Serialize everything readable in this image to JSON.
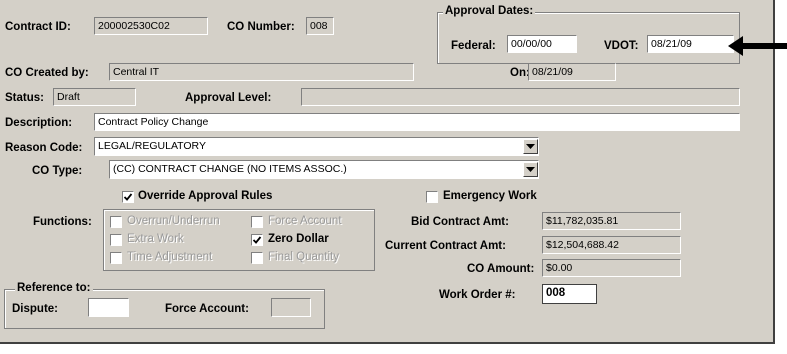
{
  "labels": {
    "contract_id": "Contract ID:",
    "co_number": "CO Number:",
    "approval_dates": "Approval Dates:",
    "federal": "Federal:",
    "vdot": "VDOT:",
    "co_created_by": "CO Created by:",
    "on": "On:",
    "status": "Status:",
    "approval_level": "Approval Level:",
    "description": "Description:",
    "reason_code": "Reason Code:",
    "co_type": "CO Type:",
    "override": "Override Approval Rules",
    "emergency": "Emergency Work",
    "functions": "Functions:",
    "bid_amt": "Bid Contract Amt:",
    "current_amt": "Current Contract Amt:",
    "co_amount": "CO Amount:",
    "work_order": "Work Order #:",
    "reference_to": "Reference to:",
    "dispute": "Dispute:",
    "force_account": "Force Account:"
  },
  "values": {
    "contract_id": "200002530C02",
    "co_number": "008",
    "federal": "00/00/00",
    "vdot": "08/21/09",
    "co_created_by": "Central IT",
    "on": "08/21/09",
    "status": "Draft",
    "approval_level": "",
    "description": "Contract Policy Change",
    "reason_code": "LEGAL/REGULATORY",
    "co_type": "(CC) CONTRACT CHANGE (NO ITEMS ASSOC.)",
    "bid_amt": "$11,782,035.81",
    "current_amt": "$12,504,688.42",
    "co_amount": "$0.00",
    "work_order": "008",
    "dispute": "",
    "force_account": ""
  },
  "checkboxes": {
    "override": true,
    "emergency": false
  },
  "functions": [
    {
      "label": "Overrun/Underrun",
      "checked": false,
      "enabled": false
    },
    {
      "label": "Force Account",
      "checked": false,
      "enabled": false
    },
    {
      "label": "Extra Work",
      "checked": false,
      "enabled": false
    },
    {
      "label": "Zero Dollar",
      "checked": true,
      "enabled": true
    },
    {
      "label": "Time Adjustment",
      "checked": false,
      "enabled": false
    },
    {
      "label": "Final Quantity",
      "checked": false,
      "enabled": false
    }
  ],
  "icons": {
    "dropdown": "chevron-down-icon",
    "pointer": "arrow-left-icon",
    "check": "checkmark-icon"
  }
}
